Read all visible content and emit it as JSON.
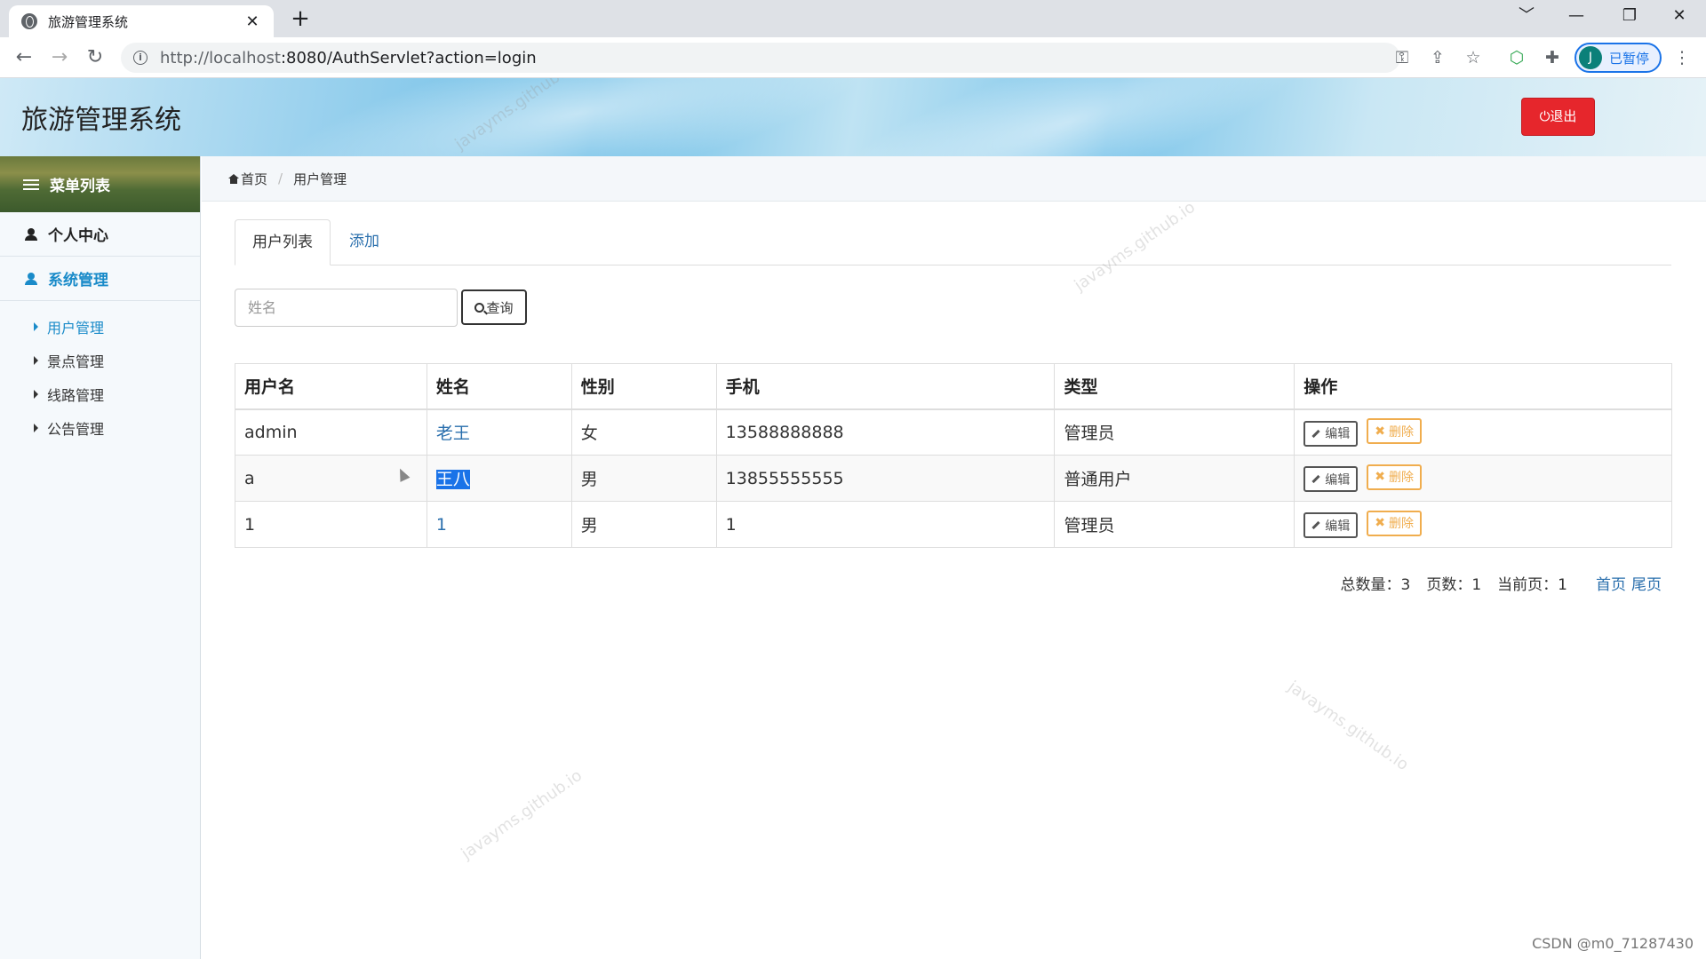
{
  "browser": {
    "tab_title": "旅游管理系统",
    "tab_close": "✕",
    "new_tab": "+",
    "url_host": "http://localhost",
    "url_rest": ":8080/AuthServlet?action=login",
    "profile_initial": "J",
    "profile_label": "已暂停",
    "window_buttons": [
      "﹀",
      "—",
      "❐",
      "✕"
    ]
  },
  "header": {
    "title": "旅游管理系统",
    "logout_label": "⏻退出",
    "logout_color": "#e6262c"
  },
  "sidebar": {
    "menu_title": "菜单列表",
    "items": [
      {
        "label": "个人中心"
      },
      {
        "label": "系统管理"
      }
    ],
    "sub_items": [
      {
        "label": "用户管理"
      },
      {
        "label": "景点管理"
      },
      {
        "label": "线路管理"
      },
      {
        "label": "公告管理"
      }
    ]
  },
  "breadcrumb": {
    "home": "首页",
    "current": "用户管理"
  },
  "tabs": [
    {
      "label": "用户列表"
    },
    {
      "label": "添加"
    }
  ],
  "search": {
    "placeholder": "姓名",
    "button_label": "查询"
  },
  "table": {
    "columns": [
      "用户名",
      "姓名",
      "性别",
      "手机",
      "类型",
      "操作"
    ],
    "rows": [
      {
        "username": "admin",
        "name": "老王",
        "gender": "女",
        "phone": "13588888888",
        "type": "管理员"
      },
      {
        "username": "a",
        "name": "王八",
        "gender": "男",
        "phone": "13855555555",
        "type": "普通用户"
      },
      {
        "username": "1",
        "name": "1",
        "gender": "男",
        "phone": "1",
        "type": "管理员"
      }
    ],
    "edit_label": "编辑",
    "delete_label": "删除"
  },
  "pager": {
    "total": "总数量：3",
    "pages": "页数：1",
    "current": "当前页：1",
    "first": "首页",
    "last": "尾页"
  },
  "watermark": "javayms.github.io",
  "footer_mark": "CSDN @m0_71287430"
}
